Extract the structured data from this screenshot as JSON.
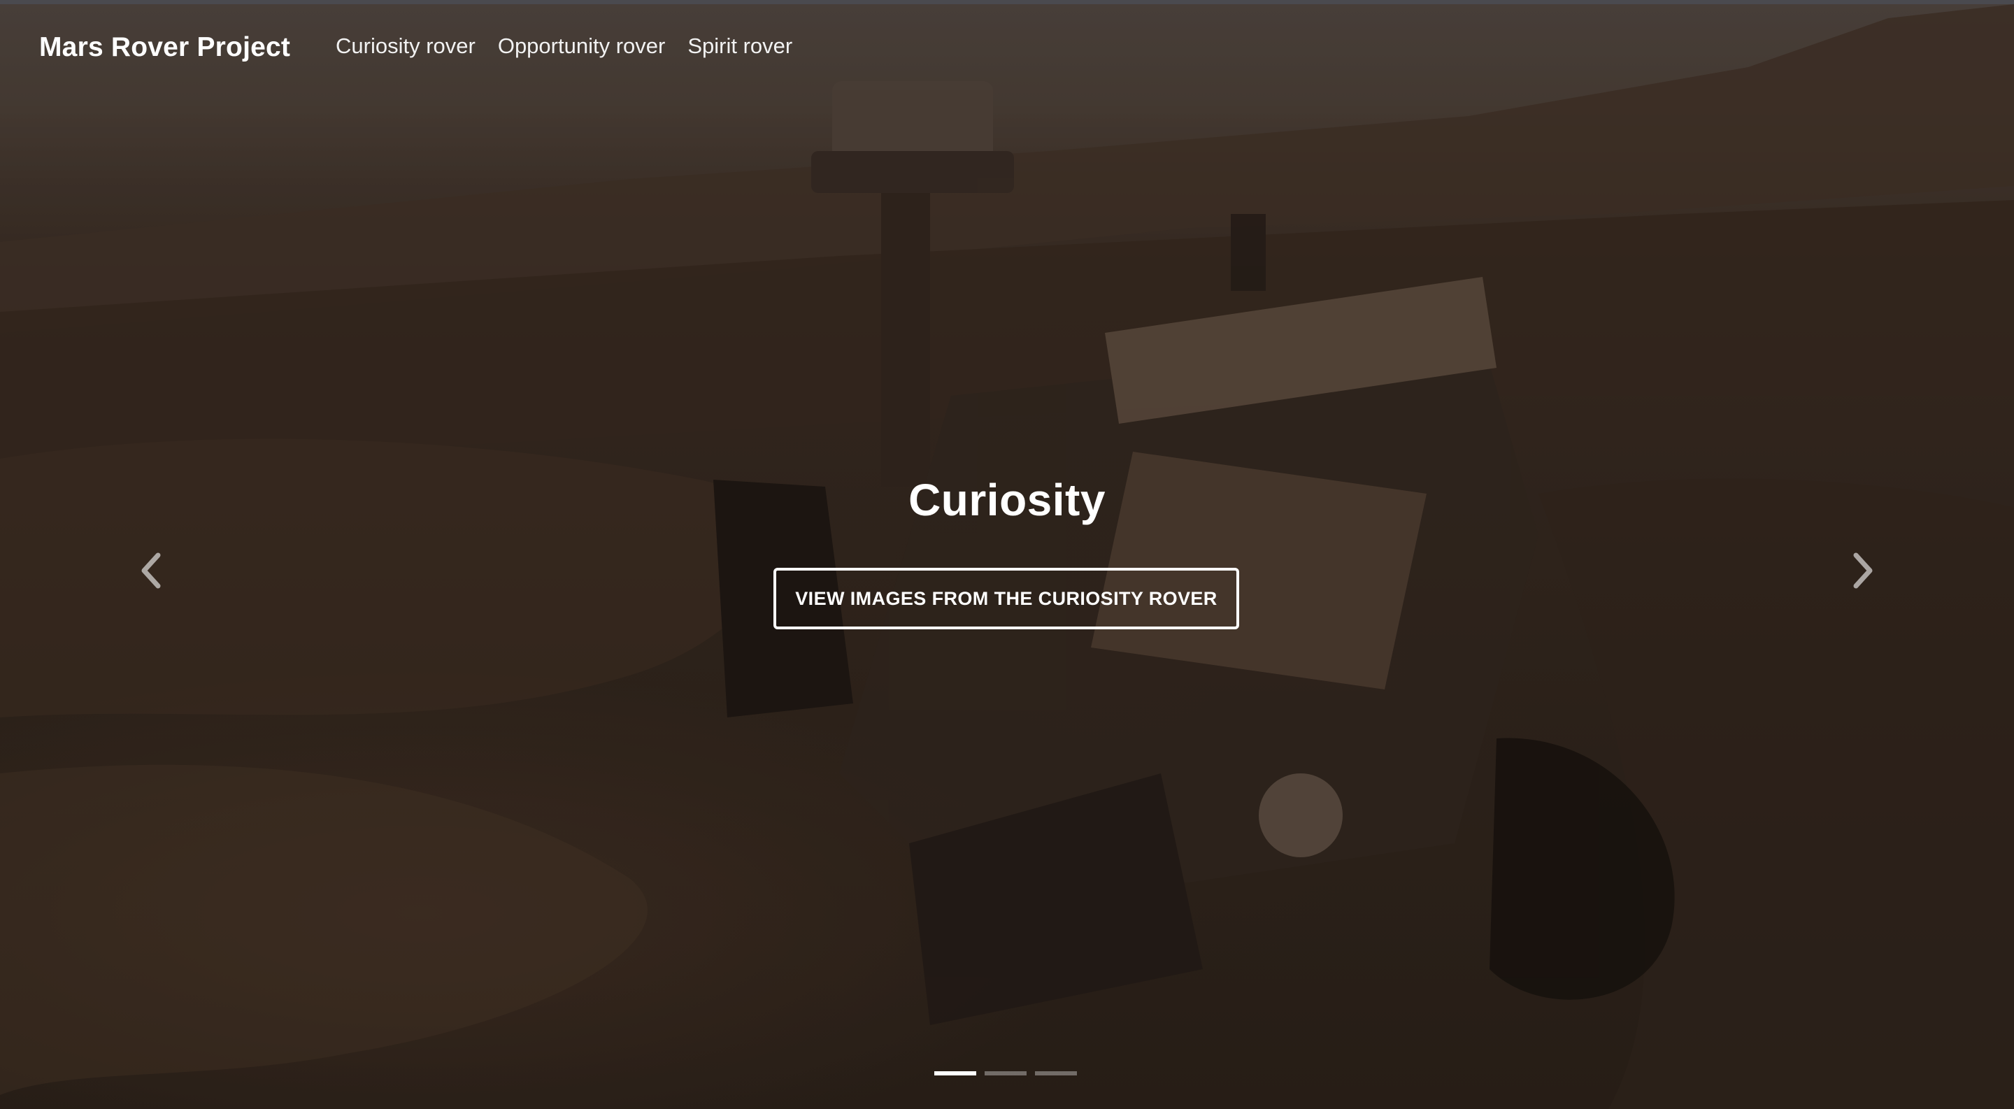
{
  "navbar": {
    "brand": "Mars Rover Project",
    "links": [
      "Curiosity rover",
      "Opportunity rover",
      "Spirit rover"
    ]
  },
  "carousel": {
    "active_index": 0,
    "slide_count": 3,
    "caption_title": "Curiosity",
    "cta_label": "VIEW IMAGES FROM THE CURIOSITY ROVER",
    "prev_icon": "chevron-left-icon",
    "next_icon": "chevron-right-icon",
    "background_image": "mars-rover-selfie-photo"
  },
  "colors": {
    "overlay": "#000000",
    "text": "#ffffff",
    "indicator_inactive": "#8a8a8a",
    "indicator_active": "#ffffff"
  }
}
